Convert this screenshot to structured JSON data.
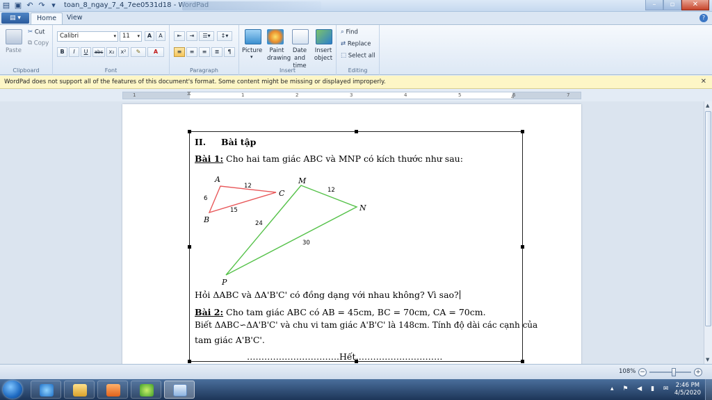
{
  "window": {
    "title": "toan_8_ngay_7_4_7ee0531d18 - WordPad",
    "controls": [
      "–",
      "▫",
      "✕"
    ]
  },
  "tabs": {
    "home": "Home",
    "view": "View"
  },
  "ribbon": {
    "clipboard": {
      "label": "Clipboard",
      "paste": "Paste",
      "cut": "Cut",
      "copy": "Copy"
    },
    "font": {
      "label": "Font",
      "family": "Calibri",
      "size": "11",
      "grow": "A",
      "shrink": "A",
      "bold": "B",
      "italic": "I",
      "underline": "U",
      "strike": "abc",
      "subscript": "x₂",
      "superscript": "x²",
      "highlight": "✎",
      "color": "A"
    },
    "paragraph": {
      "label": "Paragraph"
    },
    "insert": {
      "label": "Insert",
      "picture": "Picture",
      "paint": "Paint drawing",
      "datetime": "Date and time",
      "object": "Insert object"
    },
    "editing": {
      "label": "Editing",
      "find": "Find",
      "replace": "Replace",
      "select_all": "Select all"
    }
  },
  "infobar": {
    "text": "WordPad does not support all of the features of this document's format. Some content might be missing or displayed improperly."
  },
  "ruler": {
    "numbers": [
      "1",
      "1",
      "2",
      "3",
      "4",
      "5",
      "6",
      "7"
    ]
  },
  "document": {
    "section_number": "II.",
    "section_title": "Bài tập",
    "bai1_label": "Bài 1:",
    "bai1_text": " Cho hai tam giác ABC và MNP có kích thước như sau:",
    "figure": {
      "vertices": {
        "A": "A",
        "B": "B",
        "C": "C",
        "M": "M",
        "N": "N",
        "P": "P"
      },
      "lengths": {
        "AC": "12",
        "AB": "6",
        "BC": "15",
        "MN": "12",
        "MP": "24",
        "NP": "30"
      },
      "colors": {
        "abc": "#e8585a",
        "mnp": "#56c24a"
      }
    },
    "question": "Hỏi ΔABC và ΔA'B'C' có đồng dạng với nhau không? Vì sao?",
    "bai2_label": "Bài 2:",
    "bai2_text": " Cho tam giác ABC có AB = 45cm, BC = 70cm, CA = 70cm.",
    "bai2_line2": "Biết ΔABC∽ΔA'B'C' và chu vi tam giác A'B'C' là 148cm. Tính độ dài các cạnh của",
    "bai2_line3": "tam giác A'B'C'.",
    "end_line": "…………………………..Hết…………………………"
  },
  "statusbar": {
    "zoom": "108%",
    "zoom_out": "−",
    "zoom_in": "+"
  },
  "taskbar": {
    "time": "2:46 PM",
    "date": "4/5/2020"
  }
}
